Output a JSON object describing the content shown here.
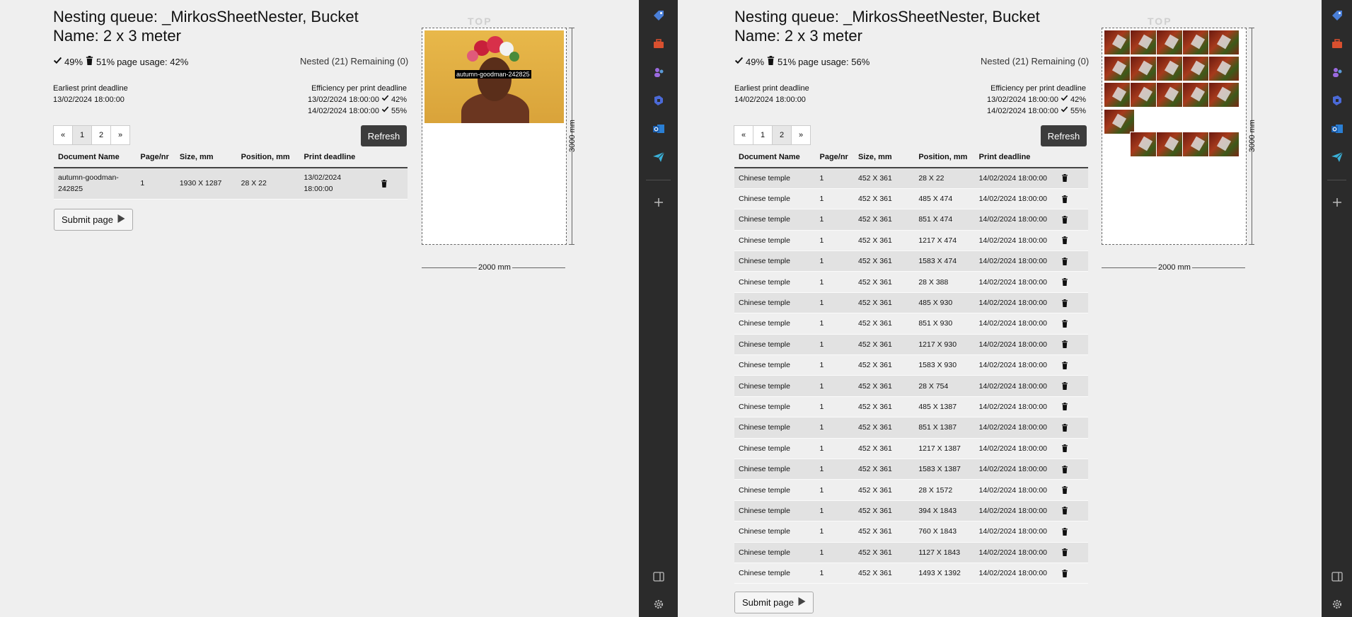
{
  "left": {
    "title": "Nesting queue: _MirkosSheetNester, Bucket Name: 2 x 3 meter",
    "stat_check": "49%",
    "stat_trash": "51%",
    "stat_usage": "page usage: 42%",
    "nested": "Nested (21) Remaining (0)",
    "earliest_label": "Earliest print deadline",
    "earliest_value": "13/02/2024 18:00:00",
    "eff_label": "Efficiency per print deadline",
    "eff": [
      {
        "date": "13/02/2024 18:00:00",
        "pct": "42%"
      },
      {
        "date": "14/02/2024 18:00:00",
        "pct": "55%"
      }
    ],
    "pager": [
      "«",
      "1",
      "2",
      "»"
    ],
    "refresh": "Refresh",
    "columns": [
      "Document Name",
      "Page/nr",
      "Size, mm",
      "Position, mm",
      "Print deadline"
    ],
    "rows": [
      {
        "name": "autumn-goodman-242825",
        "page": "1",
        "size": "1930 X 1287",
        "position": "28 X 22",
        "deadline": "13/02/2024 18:00:00"
      }
    ],
    "submit": "Submit page",
    "preview": {
      "top": "TOP",
      "height_label": "3000 mm",
      "width_label": "2000 mm",
      "image_tag": "autumn-goodman-242825"
    }
  },
  "right": {
    "title": "Nesting queue: _MirkosSheetNester, Bucket Name: 2 x 3 meter",
    "stat_check": "49%",
    "stat_trash": "51%",
    "stat_usage": "page usage: 56%",
    "nested": "Nested (21) Remaining (0)",
    "earliest_label": "Earliest print deadline",
    "earliest_value": "14/02/2024 18:00:00",
    "eff_label": "Efficiency per print deadline",
    "eff": [
      {
        "date": "13/02/2024 18:00:00",
        "pct": "42%"
      },
      {
        "date": "14/02/2024 18:00:00",
        "pct": "55%"
      }
    ],
    "pager": [
      "«",
      "1",
      "2",
      "»"
    ],
    "refresh": "Refresh",
    "columns": [
      "Document Name",
      "Page/nr",
      "Size, mm",
      "Position, mm",
      "Print deadline"
    ],
    "rows": [
      {
        "name": "Chinese temple",
        "page": "1",
        "size": "452 X 361",
        "position": "28 X 22",
        "deadline": "14/02/2024 18:00:00"
      },
      {
        "name": "Chinese temple",
        "page": "1",
        "size": "452 X 361",
        "position": "485 X 474",
        "deadline": "14/02/2024 18:00:00"
      },
      {
        "name": "Chinese temple",
        "page": "1",
        "size": "452 X 361",
        "position": "851 X 474",
        "deadline": "14/02/2024 18:00:00"
      },
      {
        "name": "Chinese temple",
        "page": "1",
        "size": "452 X 361",
        "position": "1217 X 474",
        "deadline": "14/02/2024 18:00:00"
      },
      {
        "name": "Chinese temple",
        "page": "1",
        "size": "452 X 361",
        "position": "1583 X 474",
        "deadline": "14/02/2024 18:00:00"
      },
      {
        "name": "Chinese temple",
        "page": "1",
        "size": "452 X 361",
        "position": "28 X 388",
        "deadline": "14/02/2024 18:00:00"
      },
      {
        "name": "Chinese temple",
        "page": "1",
        "size": "452 X 361",
        "position": "485 X 930",
        "deadline": "14/02/2024 18:00:00"
      },
      {
        "name": "Chinese temple",
        "page": "1",
        "size": "452 X 361",
        "position": "851 X 930",
        "deadline": "14/02/2024 18:00:00"
      },
      {
        "name": "Chinese temple",
        "page": "1",
        "size": "452 X 361",
        "position": "1217 X 930",
        "deadline": "14/02/2024 18:00:00"
      },
      {
        "name": "Chinese temple",
        "page": "1",
        "size": "452 X 361",
        "position": "1583 X 930",
        "deadline": "14/02/2024 18:00:00"
      },
      {
        "name": "Chinese temple",
        "page": "1",
        "size": "452 X 361",
        "position": "28 X 754",
        "deadline": "14/02/2024 18:00:00"
      },
      {
        "name": "Chinese temple",
        "page": "1",
        "size": "452 X 361",
        "position": "485 X 1387",
        "deadline": "14/02/2024 18:00:00"
      },
      {
        "name": "Chinese temple",
        "page": "1",
        "size": "452 X 361",
        "position": "851 X 1387",
        "deadline": "14/02/2024 18:00:00"
      },
      {
        "name": "Chinese temple",
        "page": "1",
        "size": "452 X 361",
        "position": "1217 X 1387",
        "deadline": "14/02/2024 18:00:00"
      },
      {
        "name": "Chinese temple",
        "page": "1",
        "size": "452 X 361",
        "position": "1583 X 1387",
        "deadline": "14/02/2024 18:00:00"
      },
      {
        "name": "Chinese temple",
        "page": "1",
        "size": "452 X 361",
        "position": "28 X 1572",
        "deadline": "14/02/2024 18:00:00"
      },
      {
        "name": "Chinese temple",
        "page": "1",
        "size": "452 X 361",
        "position": "394 X 1843",
        "deadline": "14/02/2024 18:00:00"
      },
      {
        "name": "Chinese temple",
        "page": "1",
        "size": "452 X 361",
        "position": "760 X 1843",
        "deadline": "14/02/2024 18:00:00"
      },
      {
        "name": "Chinese temple",
        "page": "1",
        "size": "452 X 361",
        "position": "1127 X 1843",
        "deadline": "14/02/2024 18:00:00"
      },
      {
        "name": "Chinese temple",
        "page": "1",
        "size": "452 X 361",
        "position": "1493 X 1392",
        "deadline": "14/02/2024 18:00:00"
      }
    ],
    "submit": "Submit page",
    "preview": {
      "top": "TOP",
      "height_label": "3000 mm",
      "width_label": "2000 mm"
    }
  },
  "sidebar_icons": [
    "tag-icon",
    "toolbox-icon",
    "people-icon",
    "copilot-icon",
    "outlook-icon",
    "send-icon",
    "add-icon",
    "panel-icon",
    "settings-icon"
  ]
}
